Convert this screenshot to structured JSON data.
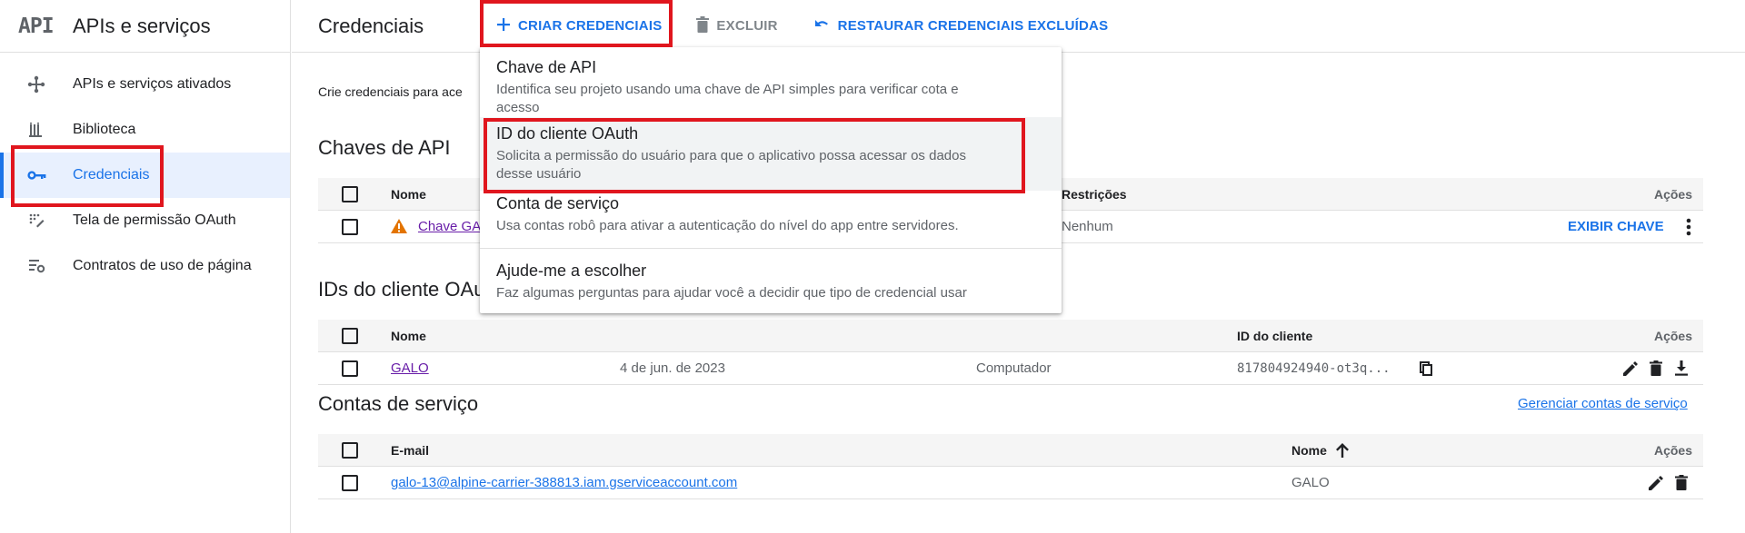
{
  "sidebar": {
    "logo": "API",
    "title": "APIs e serviços",
    "items": [
      {
        "label": "APIs e serviços ativados",
        "icon": "diamond-icon"
      },
      {
        "label": "Biblioteca",
        "icon": "library-icon"
      },
      {
        "label": "Credenciais",
        "icon": "key-icon"
      },
      {
        "label": "Tela de permissão OAuth",
        "icon": "consent-icon"
      },
      {
        "label": "Contratos de uso de página",
        "icon": "settings-list-icon"
      }
    ]
  },
  "header": {
    "title": "Credenciais",
    "create_label": "CRIAR CREDENCIAIS",
    "delete_label": "EXCLUIR",
    "restore_label": "RESTAURAR CREDENCIAIS EXCLUÍDAS"
  },
  "intro_text": "Crie credenciais para ace",
  "api_keys": {
    "title": "Chaves de API",
    "columns": {
      "name": "Nome",
      "restrictions": "Restrições",
      "actions": "Ações"
    },
    "rows": [
      {
        "name": "Chave GA",
        "restrictions": "Nenhum",
        "action": "EXIBIR CHAVE"
      }
    ]
  },
  "oauth": {
    "title": "IDs do cliente OAu",
    "columns": {
      "name": "Nome",
      "client_id": "ID do cliente",
      "actions": "Ações"
    },
    "rows": [
      {
        "name": "GALO",
        "date": "4 de jun. de 2023",
        "type": "Computador",
        "client_id": "817804924940-ot3q..."
      }
    ]
  },
  "service_accounts": {
    "title": "Contas de serviço",
    "manage_link": "Gerenciar contas de serviço",
    "columns": {
      "email": "E-mail",
      "name": "Nome",
      "actions": "Ações"
    },
    "rows": [
      {
        "email": "galo-13@alpine-carrier-388813.iam.gserviceaccount.com",
        "name": "GALO"
      }
    ]
  },
  "menu": {
    "items": [
      {
        "title": "Chave de API",
        "desc1": "Identifica seu projeto usando uma chave de API simples para verificar cota e",
        "desc2": "acesso"
      },
      {
        "title": "ID do cliente OAuth",
        "desc1": "Solicita a permissão do usuário para que o aplicativo possa acessar os dados",
        "desc2": "desse usuário"
      },
      {
        "title": "Conta de serviço",
        "desc1": "Usa contas robô para ativar a autenticação do nível do app entre servidores."
      },
      {
        "title": "Ajude-me a escolher",
        "desc1": "Faz algumas perguntas para ajudar você a decidir que tipo de credencial usar"
      }
    ]
  },
  "colors": {
    "accent": "#1a73e8",
    "highlight": "#e0161e",
    "warning": "#e37400"
  }
}
